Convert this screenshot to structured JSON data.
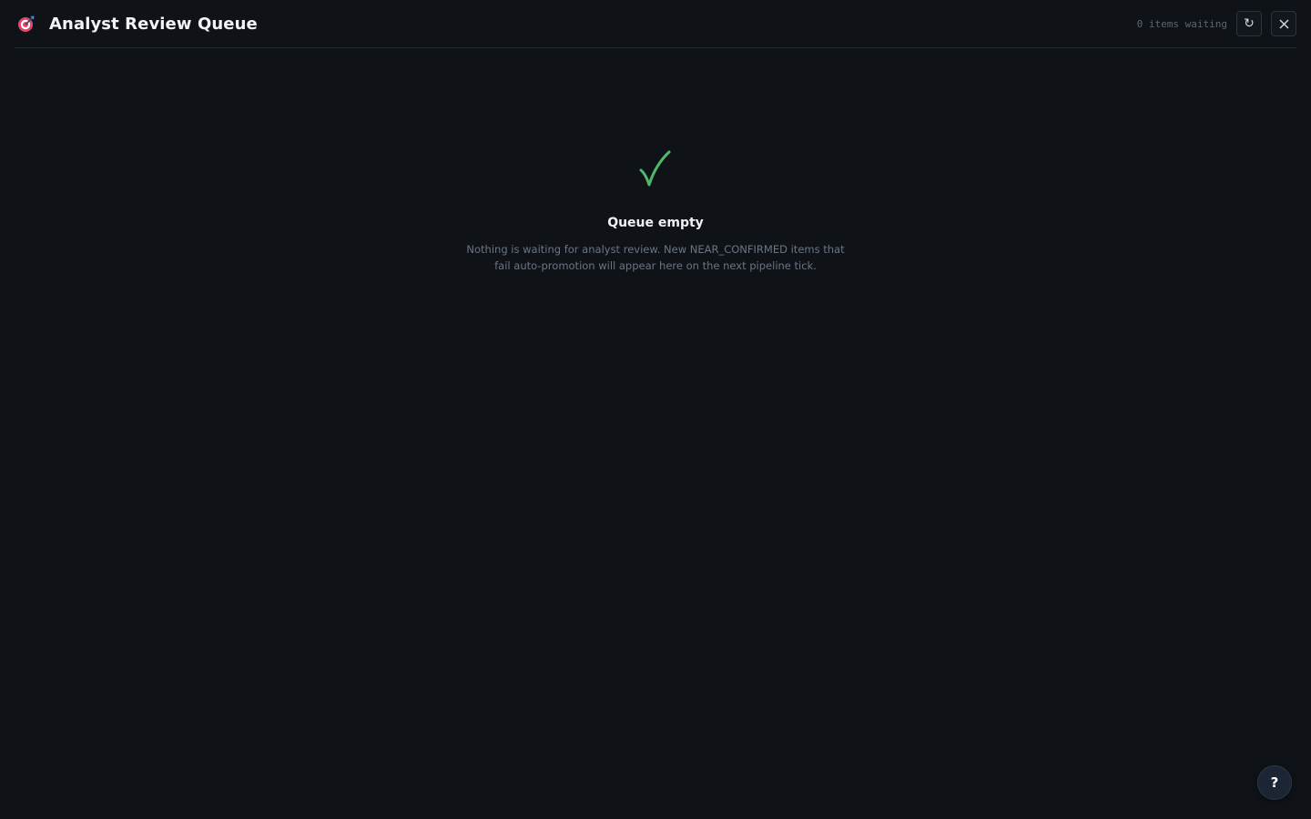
{
  "header": {
    "logo_icon": "dart-target-icon",
    "title": "Analyst Review Queue",
    "count_text": "0 items waiting",
    "refresh_icon": "refresh-icon",
    "refresh_glyph": "↻",
    "close_icon": "close-icon"
  },
  "empty_state": {
    "icon": "checkmark-icon",
    "icon_color": "#4fb96b",
    "title": "Queue empty",
    "description": "Nothing is waiting for analyst review. New NEAR_CONFIRMED items that fail auto-promotion will appear here on the next pipeline tick."
  },
  "help": {
    "label": "?"
  },
  "colors": {
    "background": "#0f1318",
    "accent_logo": "#e2466b",
    "success": "#4fb96b"
  }
}
